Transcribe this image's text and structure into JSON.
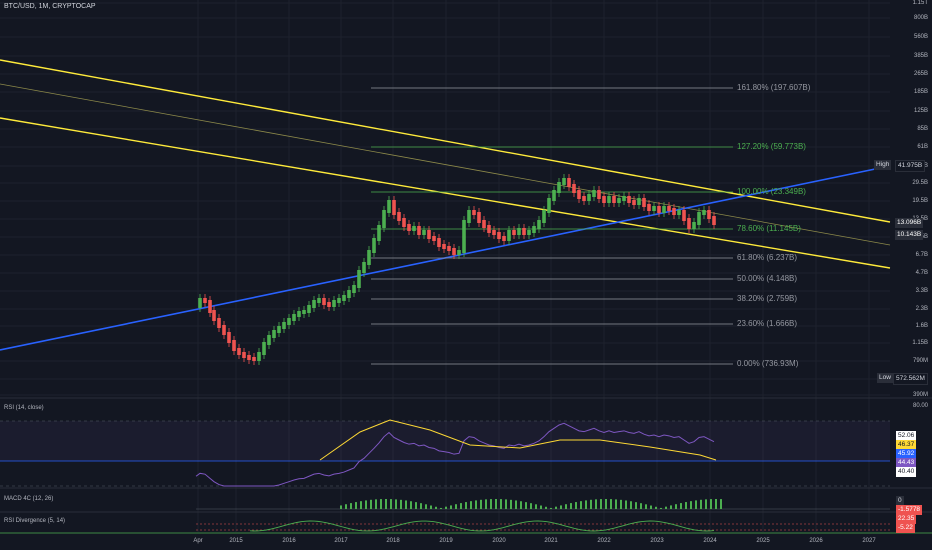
{
  "symbol": "BTC/USD, 1M, CRYPTOCAP",
  "price_axis": {
    "ticks": [
      "1.15T",
      "800B",
      "560B",
      "385B",
      "265B",
      "185B",
      "125B",
      "85B",
      "61B",
      "41B",
      "29.5B",
      "19.5B",
      "13.5B",
      "9.5B",
      "6.7B",
      "4.7B",
      "3.3B",
      "2.3B",
      "1.6B",
      "1.15B",
      "790M",
      "550M",
      "390M"
    ]
  },
  "time_axis": {
    "ticks": [
      "Apr",
      "2015",
      "2016",
      "2017",
      "2018",
      "2019",
      "2020",
      "2021",
      "2022",
      "2023",
      "2024",
      "2025",
      "2026",
      "2027"
    ]
  },
  "markers": {
    "high_label": "High",
    "high_value": "41.975B",
    "current_value": "13.096B",
    "current2_value": "10.143B",
    "low_label": "Low",
    "low_value": "572.562M"
  },
  "fib_levels": [
    {
      "label": "161.80% (197.607B)",
      "color": "#9598a1"
    },
    {
      "label": "127.20% (59.773B)",
      "color": "#4caf50"
    },
    {
      "label": "100.00% (23.349B)",
      "color": "#4caf50"
    },
    {
      "label": "78.60% (11.145B)",
      "color": "#4caf50"
    },
    {
      "label": "61.80% (6.237B)",
      "color": "#9598a1"
    },
    {
      "label": "50.00% (4.148B)",
      "color": "#9598a1"
    },
    {
      "label": "38.20% (2.759B)",
      "color": "#9598a1"
    },
    {
      "label": "23.60% (1.666B)",
      "color": "#9598a1"
    },
    {
      "label": "0.00% (736.93M)",
      "color": "#9598a1"
    }
  ],
  "rsi": {
    "label": "RSI (14, close)",
    "axis_top": "80.00",
    "values": [
      "52.06",
      "46.37",
      "45.92",
      "44.43",
      "40.40"
    ]
  },
  "macd": {
    "label": "MACD 4C (12, 26)",
    "values": [
      "0",
      "-1.5778"
    ]
  },
  "rsi_div": {
    "label": "RSI Divergence (5, 14)",
    "values": [
      "22.35",
      "-5.22"
    ]
  },
  "colors": {
    "background": "#131722",
    "bull": "#4caf50",
    "bear": "#ef5350",
    "channel": "#ffeb3b",
    "trend": "#2962ff",
    "rsi": "#7e57c2",
    "rsi_ma": "#fdd835"
  }
}
